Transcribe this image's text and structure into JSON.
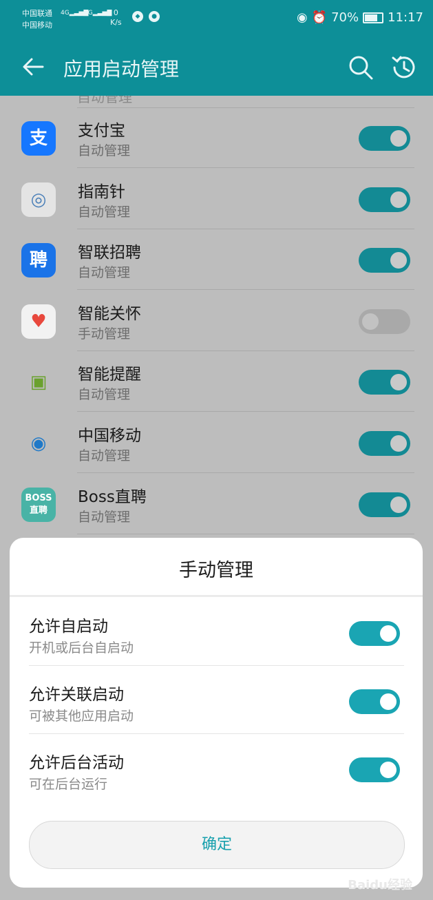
{
  "status_bar": {
    "carrier1": "中国联通",
    "carrier2": "中国移动",
    "net1": "4G",
    "net2": "2G",
    "speed_value": "0",
    "speed_unit": "K/s",
    "battery": "70%",
    "time": "11:17"
  },
  "header": {
    "title": "应用启动管理"
  },
  "apps": [
    {
      "name": "支付宝",
      "mode": "自动管理",
      "enabled": true,
      "icon": "alipay-icon",
      "glyph": "支",
      "bg": "#1677ff",
      "fg": "#ffffff"
    },
    {
      "name": "指南针",
      "mode": "自动管理",
      "enabled": true,
      "icon": "compass-icon",
      "glyph": "◎",
      "bg": "#e4e4e4",
      "fg": "#4a7fb8"
    },
    {
      "name": "智联招聘",
      "mode": "自动管理",
      "enabled": true,
      "icon": "zhaopin-icon",
      "glyph": "聘",
      "bg": "#1a73e8",
      "fg": "#ffffff"
    },
    {
      "name": "智能关怀",
      "mode": "手动管理",
      "enabled": false,
      "icon": "care-icon",
      "glyph": "♥",
      "bg": "#f2f2f2",
      "fg": "#e8483d"
    },
    {
      "name": "智能提醒",
      "mode": "自动管理",
      "enabled": true,
      "icon": "android-icon",
      "glyph": "▣",
      "bg": "transparent",
      "fg": "#6aa12d"
    },
    {
      "name": "中国移动",
      "mode": "自动管理",
      "enabled": true,
      "icon": "chinamobile-icon",
      "glyph": "◉",
      "bg": "transparent",
      "fg": "#1f79c8"
    },
    {
      "name": "Boss直聘",
      "mode": "自动管理",
      "enabled": true,
      "icon": "boss-icon",
      "glyph": "BOSS\n直聘",
      "bg": "#49b3a6",
      "fg": "#ffffff"
    }
  ],
  "dialog": {
    "title": "手动管理",
    "options": [
      {
        "name": "允许自启动",
        "desc": "开机或后台自启动",
        "enabled": true
      },
      {
        "name": "允许关联启动",
        "desc": "可被其他应用启动",
        "enabled": true
      },
      {
        "name": "允许后台活动",
        "desc": "可在后台运行",
        "enabled": true
      }
    ],
    "confirm_label": "确定"
  },
  "watermark": "Baidu经验"
}
